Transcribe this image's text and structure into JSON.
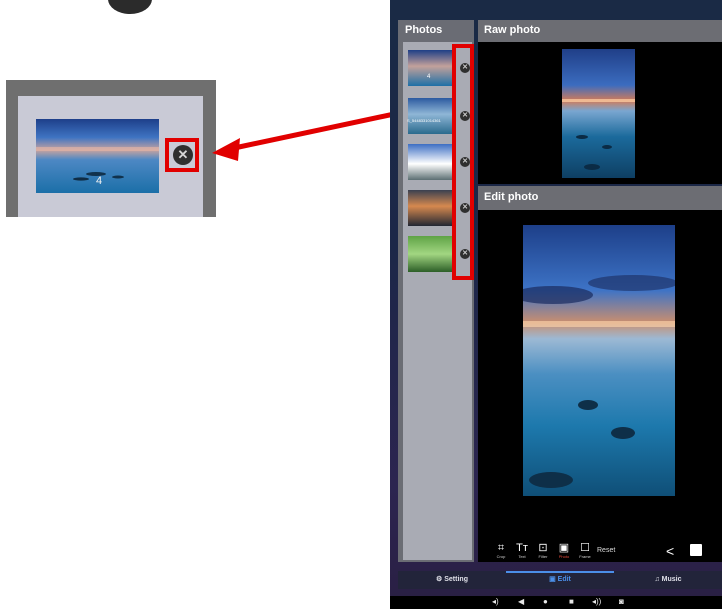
{
  "sidebar": {
    "title": "Photos",
    "items": [
      {
        "num": "4",
        "caption": "",
        "colors": [
          "#1f3f86",
          "#c3a19b",
          "#1e6fa6"
        ]
      },
      {
        "num": "",
        "caption": "S_5448331014361",
        "colors": [
          "#2c5aa0",
          "#8fb6d6",
          "#2a6a8d"
        ]
      },
      {
        "num": "",
        "caption": "",
        "colors": [
          "#3d6fc4",
          "#ffffff",
          "#5c6f73"
        ]
      },
      {
        "num": "",
        "caption": "",
        "colors": [
          "#3a4050",
          "#d6894f",
          "#222733"
        ]
      },
      {
        "num": "",
        "caption": "",
        "colors": [
          "#5fa345",
          "#a2d682",
          "#2c5e28"
        ]
      }
    ],
    "remove_icon": "close-circle-icon"
  },
  "callout": {
    "num": "4",
    "remove_icon": "close-circle-icon"
  },
  "raw": {
    "title": "Raw photo"
  },
  "edit": {
    "title": "Edit photo"
  },
  "toolbar": {
    "tools": [
      {
        "icon": "crop-icon",
        "glyph": "⌗",
        "label": "Crop"
      },
      {
        "icon": "text-icon",
        "glyph": "Tт",
        "label": "Text"
      },
      {
        "icon": "filter-icon",
        "glyph": "⊡",
        "label": "Filter"
      },
      {
        "icon": "photo-icon",
        "glyph": "▣",
        "label": "Photo"
      },
      {
        "icon": "frame-icon",
        "glyph": "☐",
        "label": "Frame"
      }
    ],
    "reset": "Reset",
    "share_icon": "share-icon",
    "save_icon": "save-icon"
  },
  "tabs": {
    "setting": "Setting",
    "edit": "Edit",
    "music": "Music"
  },
  "nav": {
    "volume_down": "◂)",
    "back": "◀",
    "home": "●",
    "recents": "■",
    "volume_up": "◂))",
    "camera": "◙"
  },
  "colors": {
    "highlight": "#e10000",
    "active_tab": "#4b8fe8",
    "active_tool": "#e24a3b"
  }
}
